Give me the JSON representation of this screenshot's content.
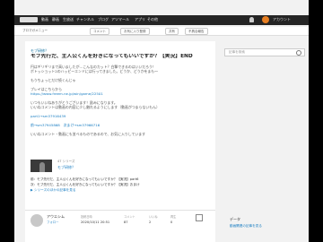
{
  "topbar": {
    "nav": [
      "動画",
      "静画",
      "生放送",
      "チャンネル",
      "ブログ",
      "アツマール",
      "アプリ",
      "その他"
    ],
    "user": "アカウント"
  },
  "subbar": {
    "menu": "ブロマガメニュー",
    "comment": "コメント",
    "favorite": "お気に入り登録",
    "share": "共有",
    "report": "不具合報告"
  },
  "article": {
    "series_tag": "モブ研修？",
    "title": "モブ先行だ、主人公くんを好きになってもいいですか？【実況】END",
    "body": [
      "円はギリギリまで高いましたが…こんなのカット？白撃できるのはいいだろう！",
      "ボトッショット2のハッピーエンドには行ってきました。どうか、どうかをまも～",
      "",
      "もうちょっとだけ続くんじゃ",
      "",
      "プレイはこちらから",
      "https://www.freem.ne.jp/win/game/22501",
      "",
      "いつもいいねありがとうございます！励みになります。",
      "いいねコメントは動画の内容に少し触れるようにします（動画がつまらないもん）",
      "",
      "part1→sm37916439",
      "",
      "前→sm37945868　次まけ→sm37966716",
      "",
      "いいねコメント・動画にも並べるものであるので、お気に入りしています"
    ],
    "series": {
      "label": "47 シリーズ",
      "name": "モブ研修？"
    },
    "nav_prev": "前：モブ先行だ、主人公くんを好きになってもいいですか？【実況】part6",
    "nav_next": "次：モブ先行だ、主人公くんを好きになってもいいですか？【実況】おまけ",
    "series_all": "▶ シリーズのほかの記事を見る"
  },
  "sidebar": {
    "search_placeholder": "記事を検索",
    "tag": "データ",
    "tag_sub": "動画関連の記事を見る"
  },
  "author": {
    "name": "アウエシム",
    "sub": "フォロー",
    "stats": [
      {
        "k": "投稿日時",
        "v": "2020/10/11 20:51"
      },
      {
        "k": "コメント",
        "v": "87"
      },
      {
        "k": "いいね",
        "v": "2"
      },
      {
        "k": "再生",
        "v": "0"
      }
    ]
  }
}
